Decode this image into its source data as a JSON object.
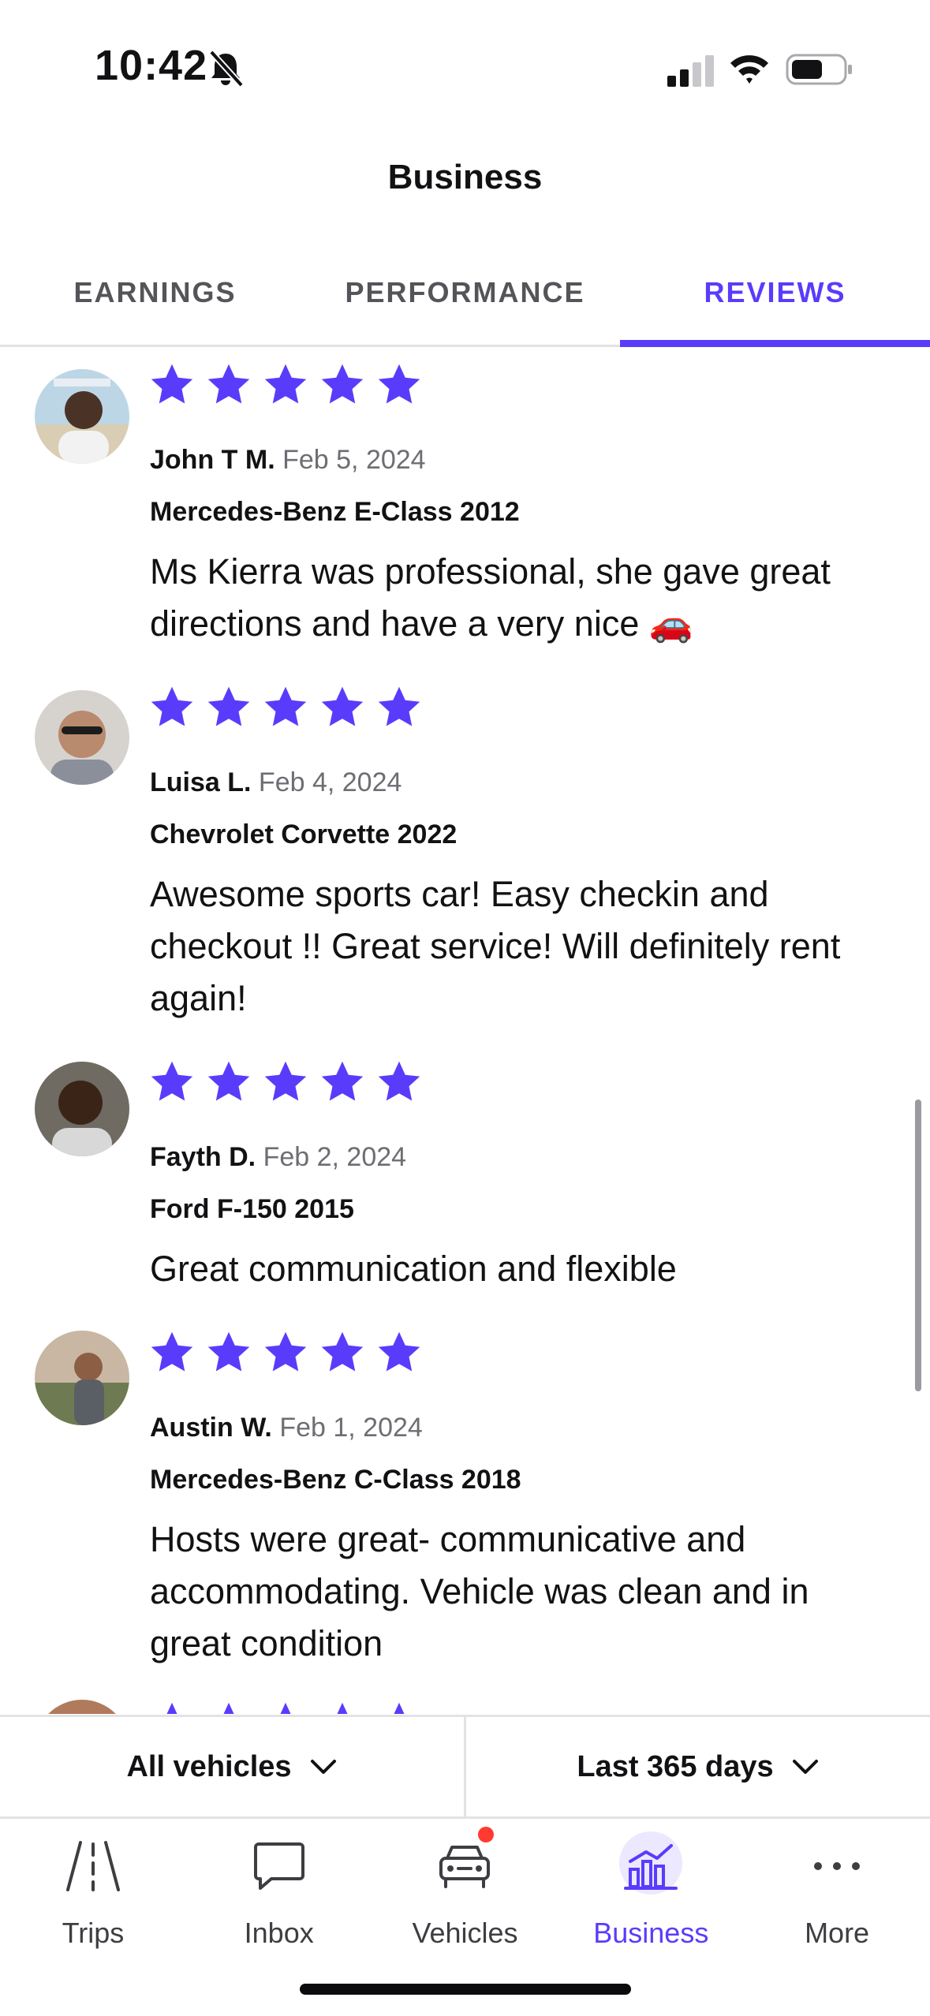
{
  "status_bar": {
    "time": "10:42"
  },
  "header": {
    "title": "Business"
  },
  "tabs": [
    {
      "label": "EARNINGS",
      "active": false
    },
    {
      "label": "PERFORMANCE",
      "active": false
    },
    {
      "label": "REVIEWS",
      "active": true
    }
  ],
  "reviews": [
    {
      "name": "John T M.",
      "date": "Feb 5, 2024",
      "vehicle": "Mercedes-Benz E-Class 2012",
      "text": "Ms Kierra was professional,  she gave great directions and have a very nice 🚗",
      "rating": 5
    },
    {
      "name": "Luisa L.",
      "date": "Feb 4, 2024",
      "vehicle": "Chevrolet Corvette 2022",
      "text": "Awesome sports car! Easy checkin and checkout !! Great service! Will definitely rent again!",
      "rating": 5
    },
    {
      "name": "Fayth D.",
      "date": "Feb 2, 2024",
      "vehicle": "Ford F-150 2015",
      "text": "Great communication and flexible",
      "rating": 5
    },
    {
      "name": "Austin W.",
      "date": "Feb 1, 2024",
      "vehicle": "Mercedes-Benz C-Class 2018",
      "text": "Hosts were great- communicative and accommodating. Vehicle was clean and in great condition",
      "rating": 5
    }
  ],
  "filters": {
    "vehicles": "All vehicles",
    "period": "Last 365 days"
  },
  "nav": [
    {
      "label": "Trips",
      "icon": "road-icon"
    },
    {
      "label": "Inbox",
      "icon": "chat-bubble-icon"
    },
    {
      "label": "Vehicles",
      "icon": "car-icon"
    },
    {
      "label": "Business",
      "icon": "chart-icon"
    },
    {
      "label": "More",
      "icon": "more-dots-icon"
    }
  ],
  "colors": {
    "accent": "#593cfb",
    "star": "#593cfb",
    "badge": "#ff3b30"
  }
}
